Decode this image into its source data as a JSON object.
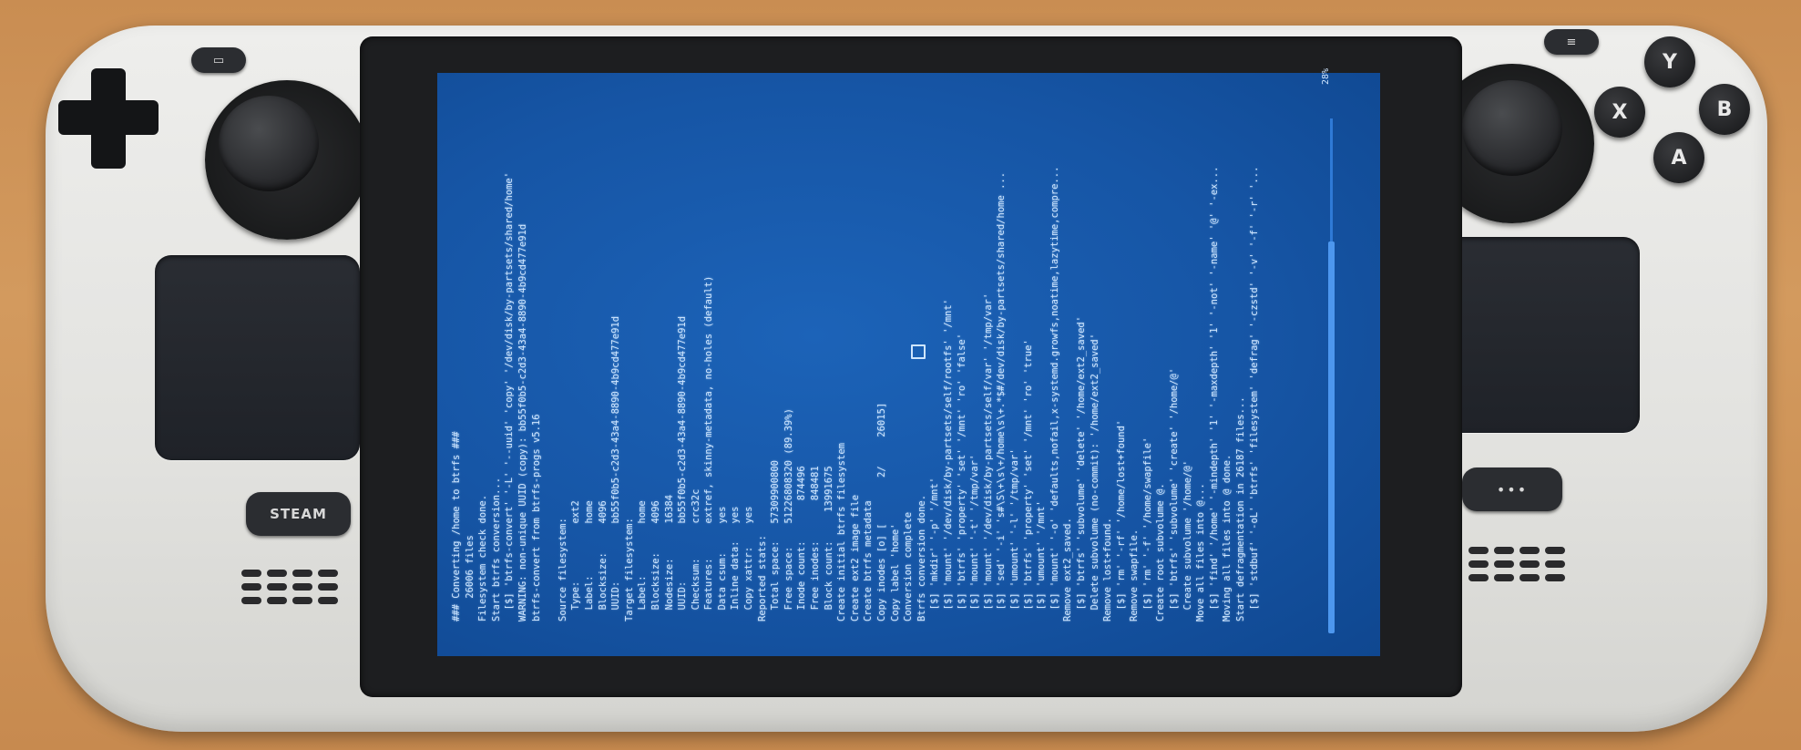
{
  "device": {
    "steam_label": "STEAM",
    "face_buttons": [
      "Y",
      "X",
      "B",
      "A"
    ],
    "view_glyph": "▭",
    "menu_glyph": "≡",
    "quick_access_glyph": "•••"
  },
  "terminal": {
    "scroll_percent": "28%",
    "lines": [
      "### Converting /home to btrfs ###",
      "    26006 files",
      "Filesystem check done.",
      "Start btrfs conversion...",
      "  [$] 'btrfs-convert' '-L' '--uuid' 'copy' '/dev/disk/by-partsets/shared/home'",
      "WARNING: non-unique UUID (copy): bb55f0b5-c2d3-43a4-8890-4b9cd477e91d",
      "btrfs-convert from btrfs-progs v5.16",
      "",
      "Source filesystem:",
      "  Type:          ext2",
      "  Label:         home",
      "  Blocksize:     4096",
      "  UUID:          bb55f0b5-c2d3-43a4-8890-4b9cd477e91d",
      "Target filesystem:",
      "  Label:         home",
      "  Blocksize:     4096",
      "  Nodesize:      16384",
      "  UUID:          bb55f0b5-c2d3-43a4-8890-4b9cd477e91d",
      "  Checksum:      crc32c",
      "  Features:      extref, skinny-metadata, no-holes (default)",
      "  Data csum:     yes",
      "  Inline data:   yes",
      "  Copy xattr:    yes",
      "Reported stats:",
      "  Total space:   57309900800",
      "  Free space:    51226808320 (89.39%)",
      "  Inode count:       874496",
      "  Free inodes:       848481",
      "  Block count:     13991675",
      "Create initial btrfs filesystem",
      "Create ext2 image file",
      "Create btrfs metadata",
      "Copy inodes [o] [        2/     26015]",
      "Copy label 'home'",
      "Conversion complete",
      "Btrfs conversion done.",
      "  [$] 'mkdir' '-p' '/mnt'",
      "  [$] 'mount' '/dev/disk/by-partsets/self/rootfs' '/mnt'",
      "  [$] 'btrfs' 'property' 'set' '/mnt' 'ro' 'false'",
      "  [$] 'mount' '-t' '/tmp/var'",
      "  [$] 'mount' '/dev/disk/by-partsets/self/var' '/tmp/var'",
      "  [$] 'sed' '-i' 's#\\S\\+\\s\\+/home\\s\\+.*$#/dev/disk/by-partsets/shared/home ...",
      "  [$] 'umount' '-l' '/tmp/var'",
      "  [$] 'btrfs' 'property' 'set' '/mnt' 'ro' 'true'",
      "  [$] 'umount' '/mnt'",
      "  [$] 'mount' '-o' 'defaults,nofail,x-systemd.growfs,noatime,lazytime,compre...",
      "Remove ext2_saved.",
      "  [$] 'btrfs' 'subvolume' 'delete' '/home/ext2_saved'",
      "  Delete subvolume (no-commit): '/home/ext2_saved'",
      "Remove lost+found.",
      "  [$] 'rm' '-rf' '/home/lost+found'",
      "Remove swapfile.",
      "  [$] 'rm' '-f' '/home/swapfile'",
      "Create root subvolume @.",
      "  [$] 'btrfs' 'subvolume' 'create' '/home/@'",
      "  Create subvolume '/home/@'",
      "Move all files into @...",
      "  [$] 'find' '/home' '-mindepth' '1' '-maxdepth' '1' '-not' '-name' '@' '-ex...",
      "Moving all files into @ done.",
      "Start defragmentation in 26187 files...",
      "  [$] 'stdbuf' '-oL' 'btrfs' 'filesystem' 'defrag' '-czstd' '-v' '-f' '-r' '..."
    ]
  }
}
